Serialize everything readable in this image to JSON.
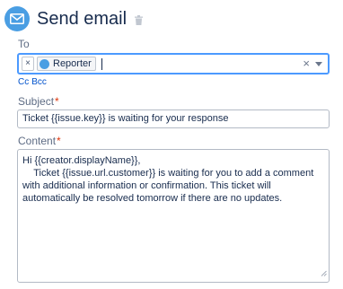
{
  "header": {
    "title": "Send email",
    "icon": "mail-icon",
    "delete_icon": "trash-icon",
    "icon_color": "#4a9ee3"
  },
  "to": {
    "label": "To",
    "chips": [
      {
        "label": "Reporter",
        "avatar": "user-avatar-icon",
        "remove_label": "×"
      }
    ],
    "clear_label": "×"
  },
  "cc_bcc": {
    "cc_label": "Cc",
    "bcc_label": "Bcc"
  },
  "subject": {
    "label": "Subject",
    "required_marker": "*",
    "value": "Ticket {{issue.key}} is waiting for your response"
  },
  "content": {
    "label": "Content",
    "required_marker": "*",
    "lines": [
      "Hi {{creator.displayName}},",
      "    Ticket {{issue.url.customer}} is waiting for you to add a comment with additional information or confirmation. This ticket will automatically be resolved tomorrow if there are no updates."
    ]
  },
  "colors": {
    "accent": "#4c9aff",
    "link": "#0052cc",
    "required": "#de350b"
  }
}
